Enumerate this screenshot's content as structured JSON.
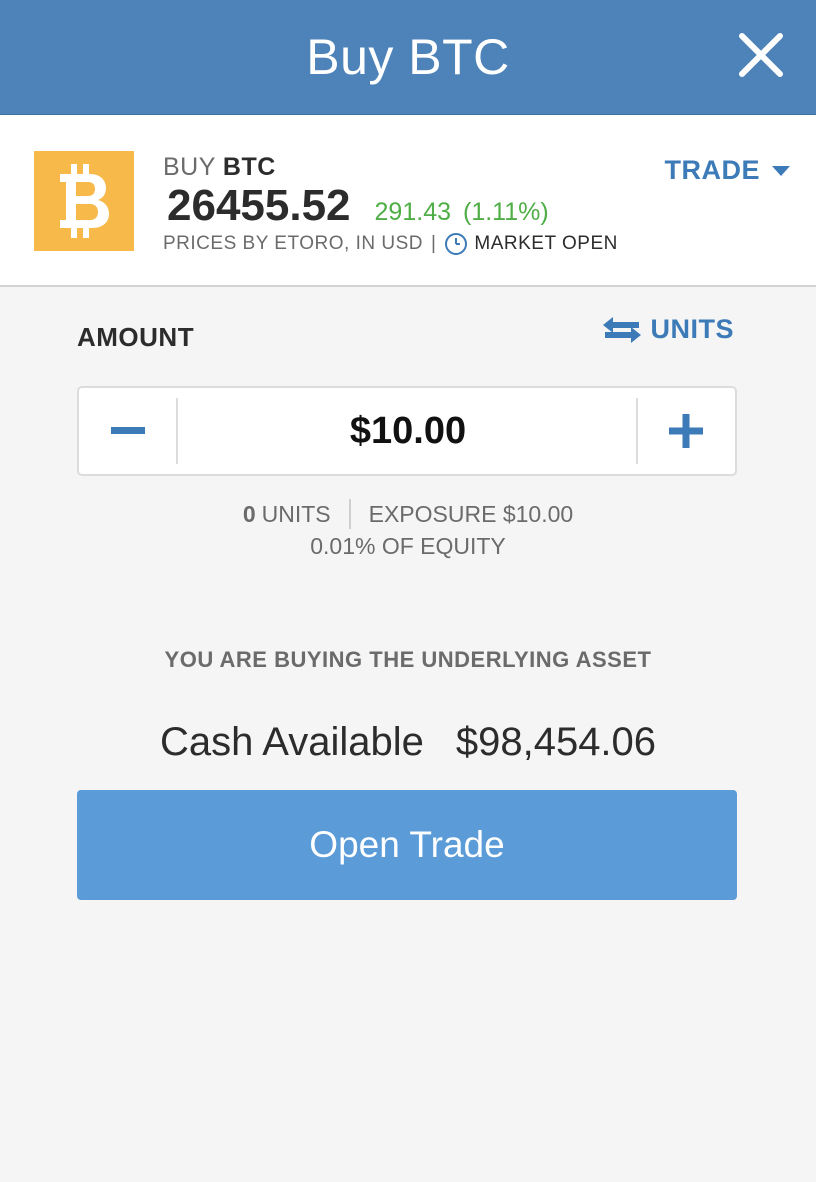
{
  "header": {
    "title": "Buy BTC",
    "close_icon": "close-icon"
  },
  "instrument": {
    "logo_icon": "bitcoin-icon",
    "logo_color": "#f6b94a",
    "side": "BUY",
    "symbol": "BTC",
    "price": "26455.52",
    "change": "291.43",
    "change_pct": "(1.11%)",
    "change_color": "#4fae46",
    "prices_source": "PRICES BY ETORO, IN USD",
    "separator": "|",
    "market_status": "MARKET OPEN",
    "trade_dropdown_label": "TRADE"
  },
  "amount": {
    "label": "AMOUNT",
    "units_toggle_label": "UNITS",
    "value": "$10.00",
    "units_count": "0",
    "units_label": "UNITS",
    "exposure": "EXPOSURE $10.00",
    "equity": "0.01% OF EQUITY"
  },
  "note": "YOU ARE BUYING THE UNDERLYING ASSET",
  "cash": {
    "label": "Cash Available",
    "value": "$98,454.06"
  },
  "open_trade_label": "Open Trade",
  "colors": {
    "header_bg": "#4d83b8",
    "accent": "#3c7ab8",
    "button_bg": "#5a9bd8",
    "positive": "#4fae46"
  }
}
